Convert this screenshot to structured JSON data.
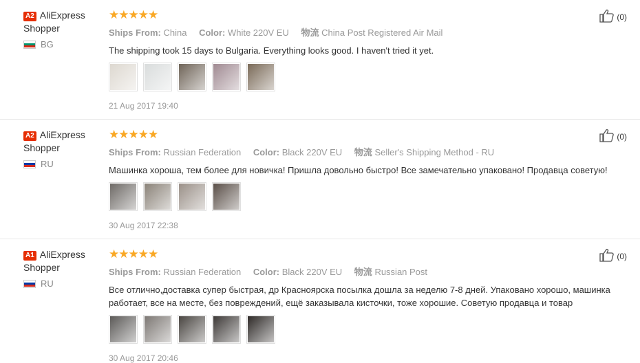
{
  "reviews": [
    {
      "badge": "A2",
      "user_line1": "AliExpress",
      "user_line2": "Shopper",
      "country": "BG",
      "flag": [
        "#ffffff",
        "#00966e",
        "#d62612"
      ],
      "stars": "★★★★★",
      "ships_from_label": "Ships From:",
      "ships_from": "China",
      "color_label": "Color:",
      "color": "White 220V EU",
      "logistics_label": "物流",
      "logistics": "China Post Registered Air Mail",
      "text": "The shipping took 15 days to Bulgaria. Everything looks good. I haven't tried it yet.",
      "thumbs": [
        "#ddd8d0",
        "#d9dcdc",
        "#6f6458",
        "#a08a92",
        "#7a6a58"
      ],
      "date": "21 Aug 2017 19:40",
      "likes": "(0)"
    },
    {
      "badge": "A2",
      "user_line1": "AliExpress",
      "user_line2": "Shopper",
      "country": "RU",
      "flag": [
        "#ffffff",
        "#0039a6",
        "#d52b1e"
      ],
      "stars": "★★★★★",
      "ships_from_label": "Ships From:",
      "ships_from": "Russian Federation",
      "color_label": "Color:",
      "color": "Black 220V EU",
      "logistics_label": "物流",
      "logistics": "Seller's Shipping Method - RU",
      "text": "Машинка хороша, тем более для новичка! Пришла довольно быстро! Все замечательно упаковано! Продавца советую!",
      "thumbs": [
        "#6e6a66",
        "#8a8278",
        "#9a9088",
        "#5a4f48"
      ],
      "date": "30 Aug 2017 22:38",
      "likes": "(0)"
    },
    {
      "badge": "A1",
      "user_line1": "AliExpress",
      "user_line2": "Shopper",
      "country": "RU",
      "flag": [
        "#ffffff",
        "#0039a6",
        "#d52b1e"
      ],
      "stars": "★★★★★",
      "ships_from_label": "Ships From:",
      "ships_from": "Russian Federation",
      "color_label": "Color:",
      "color": "Black 220V EU",
      "logistics_label": "物流",
      "logistics": "Russian Post",
      "text": "Все отлично,доставка супер быстрая, др Красноярска посылка дошла за неделю 7-8 дней. Упаковано хорошо, машинка работает, все на месте, без повреждений, ещё заказывала кисточки, тоже хорошие. Советую продавца и товар",
      "thumbs": [
        "#5c5a58",
        "#7d7874",
        "#4a4642",
        "#3e3a38",
        "#2e2a28"
      ],
      "date": "30 Aug 2017 20:46",
      "likes": "(0)"
    }
  ]
}
